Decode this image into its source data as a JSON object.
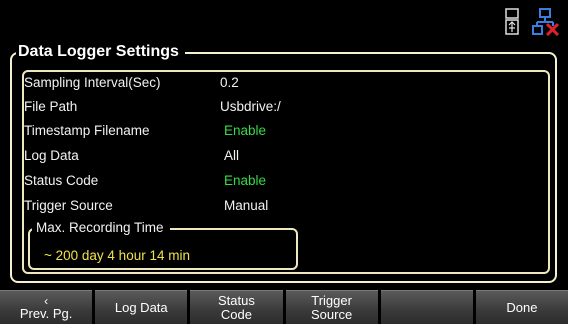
{
  "status_icons": [
    "usb-drive-icon",
    "network-disconnected-icon"
  ],
  "panel": {
    "title": "Data Logger Settings",
    "settings": [
      {
        "label": "Sampling Interval(Sec)",
        "value": "0.2",
        "color": "#f2f2f2"
      },
      {
        "label": "File Path",
        "value": "Usbdrive:/",
        "color": "#f2f2f2"
      },
      {
        "label": "Timestamp Filename",
        "value": "Enable",
        "color": "#39d94a"
      },
      {
        "label": "Log Data",
        "value": "All",
        "color": "#f2f2f2"
      },
      {
        "label": "Status Code",
        "value": "Enable",
        "color": "#39d94a"
      },
      {
        "label": "Trigger Source",
        "value": "Manual",
        "color": "#f2f2f2"
      }
    ],
    "recording": {
      "label": "Max. Recording Time",
      "value": "~ 200 day  4 hour  14 min"
    }
  },
  "softkeys": [
    {
      "arrow": "‹",
      "line1": "Prev. Pg.",
      "line2": ""
    },
    {
      "arrow": "",
      "line1": "Log Data",
      "line2": ""
    },
    {
      "arrow": "",
      "line1": "Status",
      "line2": "Code"
    },
    {
      "arrow": "",
      "line1": "Trigger",
      "line2": "Source"
    },
    {
      "arrow": "",
      "line1": "",
      "line2": ""
    },
    {
      "arrow": "",
      "line1": "Done",
      "line2": ""
    }
  ]
}
